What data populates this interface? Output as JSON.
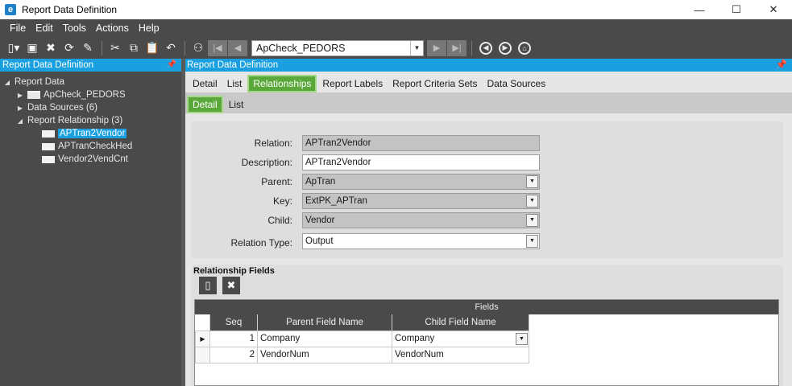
{
  "window": {
    "title": "Report Data Definition",
    "controls": [
      "—",
      "☐",
      "✕"
    ]
  },
  "menu": [
    "File",
    "Edit",
    "Tools",
    "Actions",
    "Help"
  ],
  "toolbar": {
    "key_value": "ApCheck_PEDORS"
  },
  "left_panel": {
    "title": "Report Data Definition",
    "tree": [
      {
        "label": "Report Data",
        "arrow": "◢",
        "indent": 0,
        "icon": "none"
      },
      {
        "label": "ApCheck_PEDORS",
        "arrow": "▶",
        "indent": 1,
        "icon": "folder"
      },
      {
        "label": "Data Sources (6)",
        "arrow": "▶",
        "indent": 1,
        "icon": "none"
      },
      {
        "label": "Report Relationship (3)",
        "arrow": "◢",
        "indent": 1,
        "icon": "none"
      },
      {
        "label": "APTran2Vendor",
        "arrow": "",
        "indent": 2,
        "icon": "doc",
        "selected": true
      },
      {
        "label": "APTranCheckHed",
        "arrow": "",
        "indent": 2,
        "icon": "doc"
      },
      {
        "label": "Vendor2VendCnt",
        "arrow": "",
        "indent": 2,
        "icon": "doc"
      }
    ]
  },
  "right_panel": {
    "title": "Report Data Definition",
    "tabs": [
      "Detail",
      "List",
      "Relationships",
      "Report Labels",
      "Report Criteria Sets",
      "Data Sources"
    ],
    "active_tab": "Relationships",
    "subtabs": [
      "Detail",
      "List"
    ],
    "active_subtab": "Detail"
  },
  "form": {
    "relation_label": "Relation:",
    "relation_value": "APTran2Vendor",
    "description_label": "Description:",
    "description_value": "APTran2Vendor",
    "parent_label": "Parent:",
    "parent_value": "ApTran",
    "key_label": "Key:",
    "key_value": "ExtPK_APTran",
    "child_label": "Child:",
    "child_value": "Vendor",
    "relation_type_label": "Relation Type:",
    "relation_type_value": "Output"
  },
  "relationship_fields": {
    "title": "Relationship Fields",
    "band": "Fields",
    "columns": [
      "Seq",
      "Parent Field Name",
      "Child Field Name"
    ],
    "rows": [
      {
        "seq": "1",
        "parent": "Company",
        "child": "Company"
      },
      {
        "seq": "2",
        "parent": "VendorNum",
        "child": "VendorNum"
      }
    ]
  }
}
